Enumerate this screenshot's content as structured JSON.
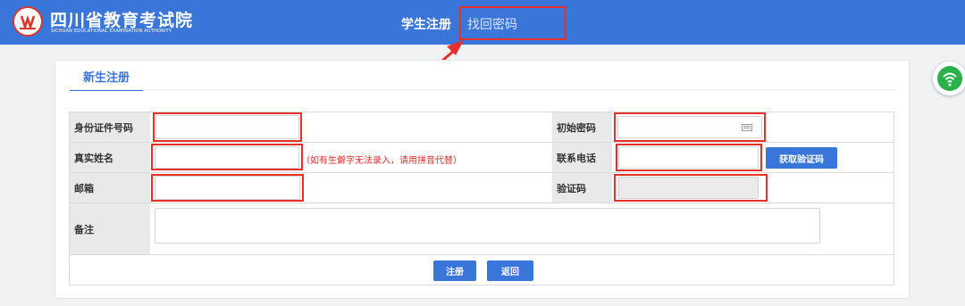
{
  "header": {
    "logo_cn": "四川省教育考试院",
    "logo_en": "SICHUAN EDUCATIONAL EXAMINATION AUTHORITY",
    "nav": {
      "register": "学生注册",
      "reset_password": "找回密码"
    }
  },
  "tab": {
    "label": "新生注册"
  },
  "form": {
    "id_label": "身份证件号码",
    "password_label": "初始密码",
    "name_label": "真实姓名",
    "name_hint": "（如有生僻字无法录入，请用拼音代替）",
    "phone_label": "联系电话",
    "get_code_button": "获取验证码",
    "email_label": "邮箱",
    "code_label": "验证码",
    "remark_label": "备注",
    "submit_button": "注册",
    "back_button": "返回"
  },
  "colors": {
    "header_bg": "#3a75d9",
    "highlight": "#e8302b",
    "button": "#3a75d9",
    "label_bg": "#e9e9e9"
  }
}
